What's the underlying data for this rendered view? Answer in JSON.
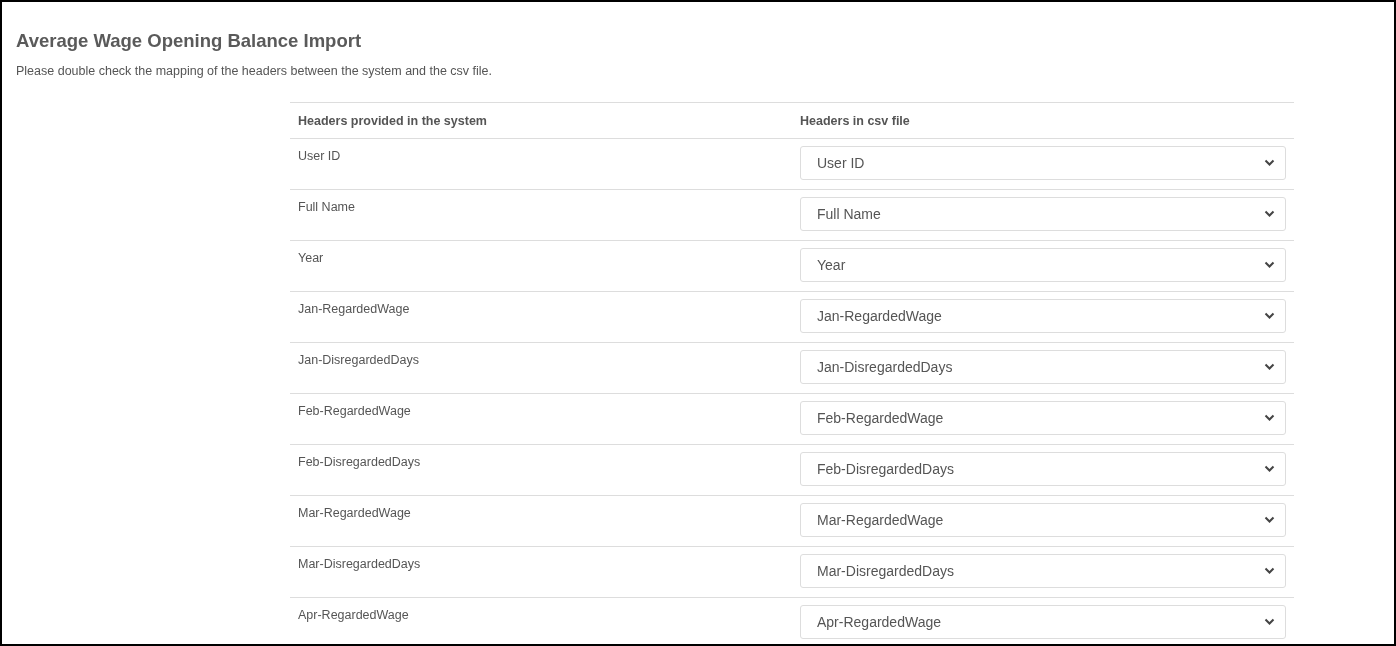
{
  "title": "Average Wage Opening Balance Import",
  "description": "Please double check the mapping of the headers between the system and the csv file.",
  "table": {
    "columns": [
      "Headers provided in the system",
      "Headers in csv file"
    ],
    "rows": [
      {
        "system_header": "User ID",
        "csv_header": "User ID"
      },
      {
        "system_header": "Full Name",
        "csv_header": "Full Name"
      },
      {
        "system_header": "Year",
        "csv_header": "Year"
      },
      {
        "system_header": "Jan-RegardedWage",
        "csv_header": "Jan-RegardedWage"
      },
      {
        "system_header": "Jan-DisregardedDays",
        "csv_header": "Jan-DisregardedDays"
      },
      {
        "system_header": "Feb-RegardedWage",
        "csv_header": "Feb-RegardedWage"
      },
      {
        "system_header": "Feb-DisregardedDays",
        "csv_header": "Feb-DisregardedDays"
      },
      {
        "system_header": "Mar-RegardedWage",
        "csv_header": "Mar-RegardedWage"
      },
      {
        "system_header": "Mar-DisregardedDays",
        "csv_header": "Mar-DisregardedDays"
      },
      {
        "system_header": "Apr-RegardedWage",
        "csv_header": "Apr-RegardedWage"
      }
    ]
  }
}
